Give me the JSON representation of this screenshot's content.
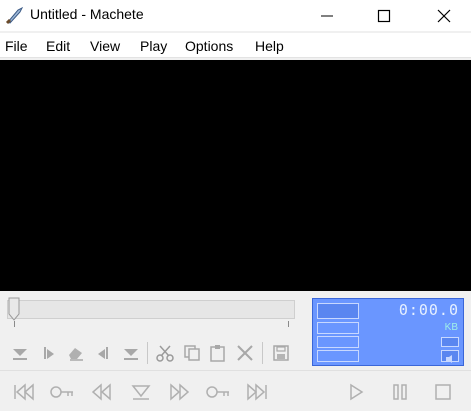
{
  "window": {
    "title": "Untitled - Machete",
    "icon": "machete-app-icon",
    "controls": [
      "minimize-icon",
      "maximize-icon",
      "close-icon"
    ]
  },
  "menu": {
    "items": [
      {
        "label": "File"
      },
      {
        "label": "Edit"
      },
      {
        "label": "View"
      },
      {
        "label": "Play"
      },
      {
        "label": "Options"
      },
      {
        "label": "Help"
      }
    ]
  },
  "display": {
    "time": "0:00.0",
    "size_unit": "KB",
    "accent_color": "#6a96ff"
  },
  "seek": {
    "position": 0
  },
  "edit_toolbar": {
    "icons": [
      "mark-in-icon",
      "select-forward-icon",
      "erase-icon",
      "select-back-icon",
      "mark-out-icon",
      "cut-icon",
      "copy-icon",
      "paste-icon",
      "delete-icon",
      "save-icon"
    ]
  },
  "play_toolbar": {
    "icons": [
      "go-to-start-icon",
      "previous-keyframe-icon",
      "rewind-icon",
      "play-selection-icon",
      "fast-forward-icon",
      "next-keyframe-icon",
      "go-to-end-icon",
      "play-icon",
      "pause-icon",
      "stop-icon"
    ]
  }
}
